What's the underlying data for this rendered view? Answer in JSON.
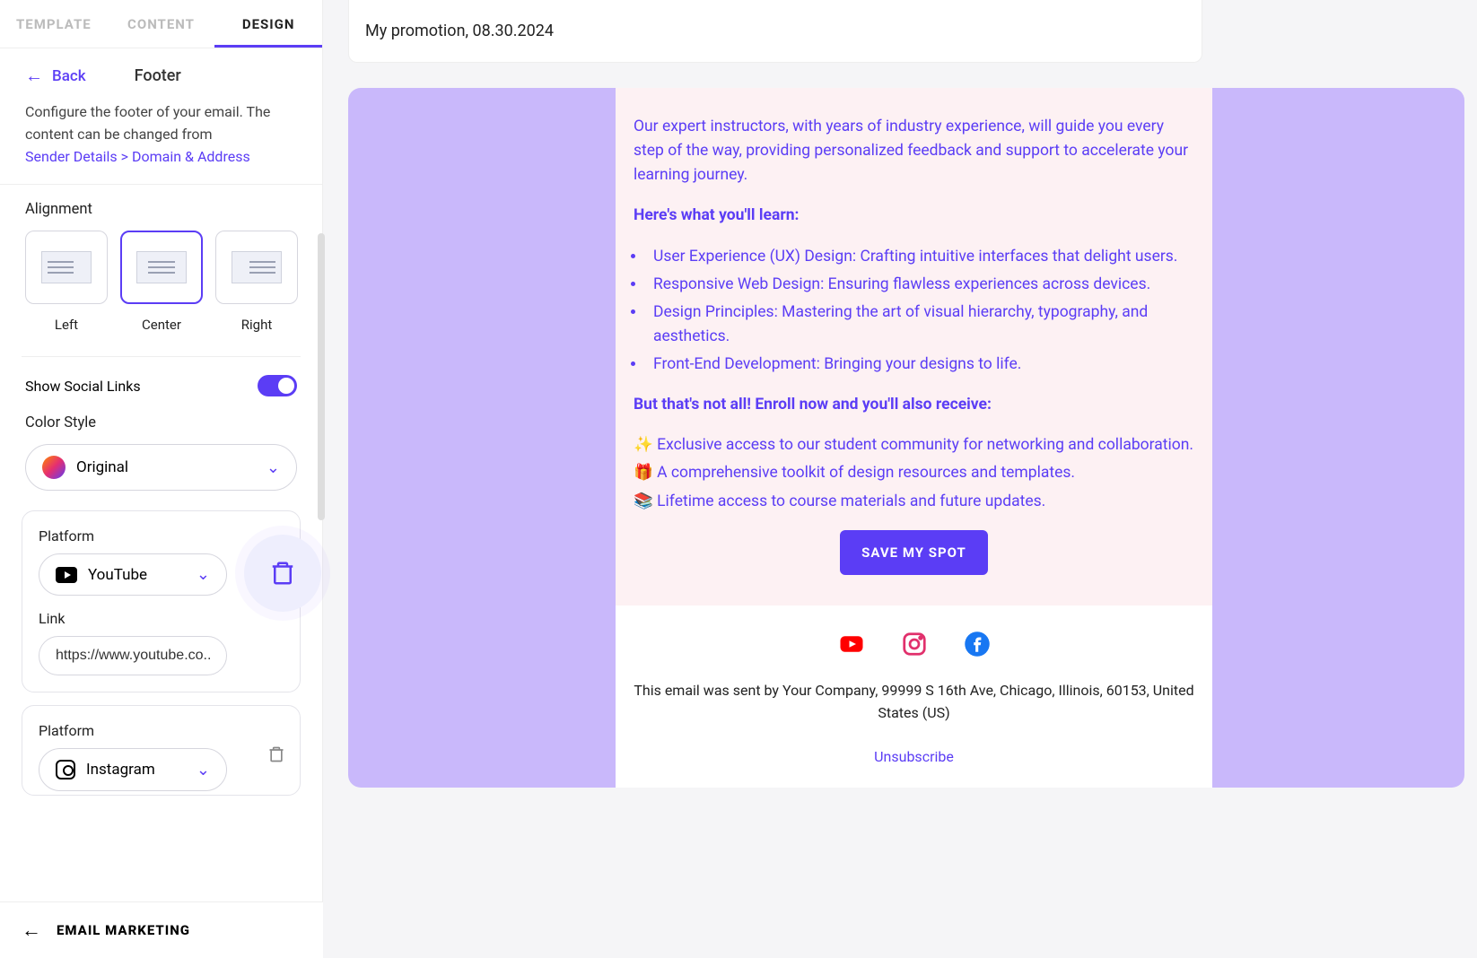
{
  "tabs": {
    "template": "TEMPLATE",
    "content": "CONTENT",
    "design": "DESIGN"
  },
  "back": {
    "label": "Back",
    "title": "Footer"
  },
  "desc": {
    "line": "Configure the footer of your email. The content can be changed from",
    "link": "Sender Details > Domain & Address"
  },
  "alignment": {
    "label": "Alignment",
    "left": "Left",
    "center": "Center",
    "right": "Right"
  },
  "showSocial": {
    "label": "Show Social Links"
  },
  "colorStyle": {
    "label": "Color Style",
    "value": "Original"
  },
  "platform1": {
    "labelP": "Platform",
    "value": "YouTube",
    "labelL": "Link",
    "link": "https://www.youtube.co..."
  },
  "platform2": {
    "labelP": "Platform",
    "value": "Instagram"
  },
  "bottom": {
    "label": "EMAIL MARKETING"
  },
  "top": {
    "title": "My promotion, 08.30.2024"
  },
  "email": {
    "intro": "Our expert instructors, with years of industry experience, will guide you every step of the way, providing personalized feedback and support to accelerate your learning journey.",
    "h1": "Here's what you'll learn:",
    "li1": "User Experience (UX) Design: Crafting intuitive interfaces that delight users.",
    "li2": "Responsive Web Design: Ensuring flawless experiences across devices.",
    "li3": "Design Principles: Mastering the art of visual hierarchy, typography, and aesthetics.",
    "li4": "Front-End Development: Bringing your designs to life.",
    "h2": "But that's not all! Enroll now and you'll also receive:",
    "b1": "✨ Exclusive access to our student community for networking and collaboration.",
    "b2": "🎁 A comprehensive toolkit of design resources and templates.",
    "b3": "📚 Lifetime access to course materials and future updates.",
    "cta": "SAVE MY SPOT",
    "addr": "This email was sent by Your Company, 99999 S 16th Ave, Chicago, Illinois, 60153, United States (US)",
    "unsub": "Unsubscribe"
  }
}
